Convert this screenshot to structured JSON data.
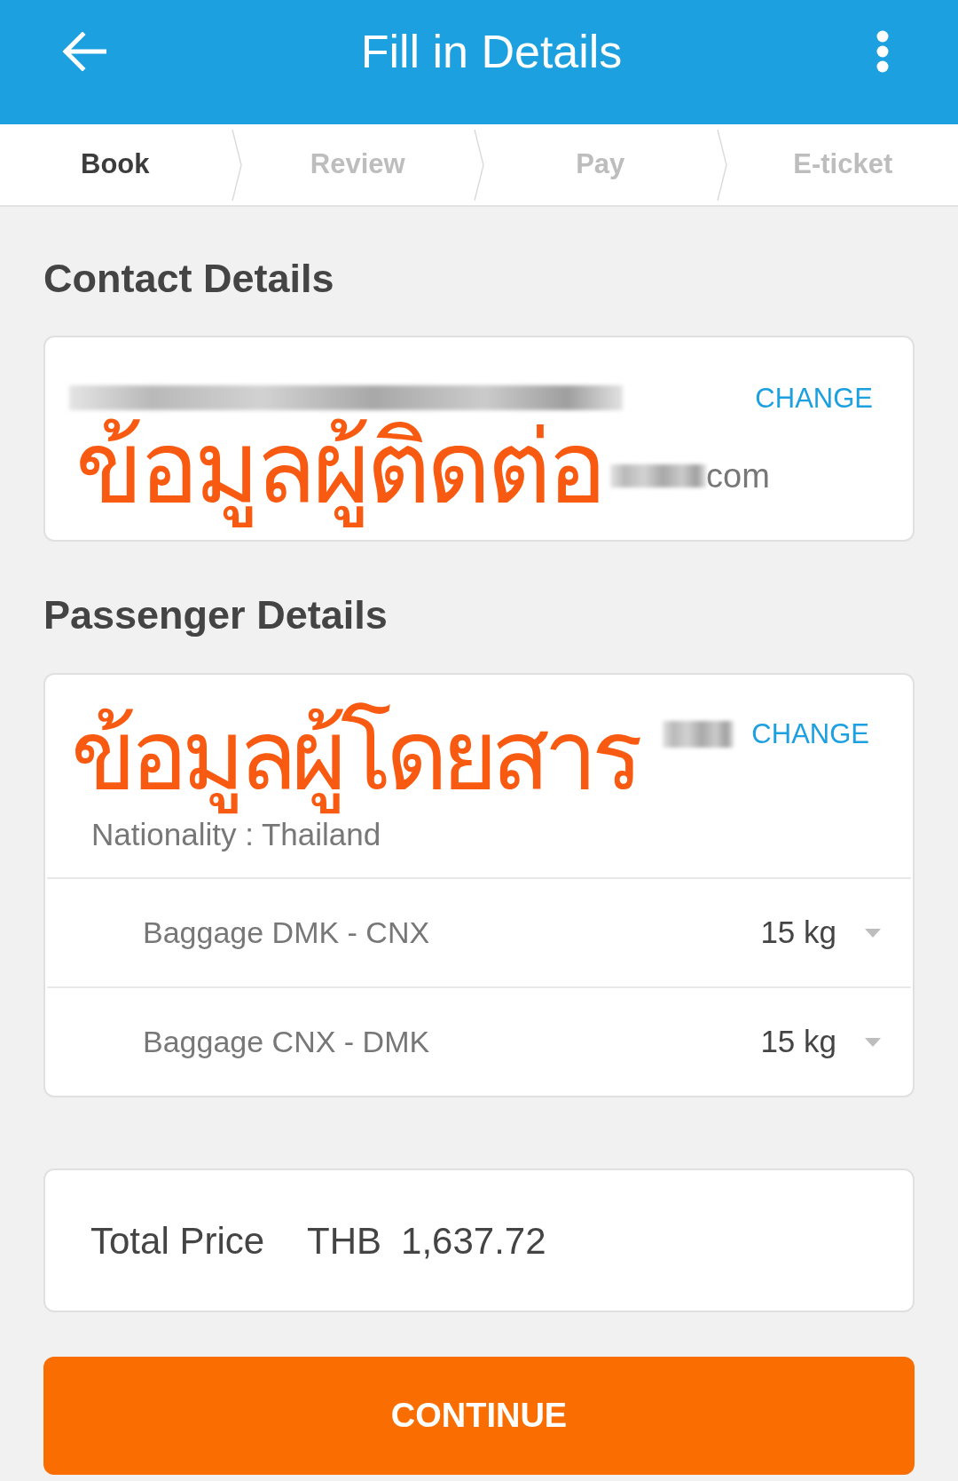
{
  "app_bar": {
    "title": "Fill in Details"
  },
  "steps": [
    {
      "label": "Book",
      "selected": true
    },
    {
      "label": "Review",
      "selected": false
    },
    {
      "label": "Pay",
      "selected": false
    },
    {
      "label": "E-ticket",
      "selected": false
    }
  ],
  "contact": {
    "heading": "Contact Details",
    "action": "CHANGE",
    "email_end": "com",
    "annotation": "ข้อมูลผู้ติดต่อ"
  },
  "passenger": {
    "heading": "Passenger Details",
    "action": "CHANGE",
    "nationality": "Nationality : Thailand",
    "annotation": "ข้อมูลผู้โดยสาร",
    "baggage": [
      {
        "label": "Baggage DMK - CNX",
        "value": "15 kg"
      },
      {
        "label": "Baggage CNX - DMK",
        "value": "15 kg"
      }
    ]
  },
  "total": {
    "label": "Total Price",
    "currency": "THB",
    "amount": "1,637.72"
  },
  "button": {
    "label": "CONTINUE"
  }
}
